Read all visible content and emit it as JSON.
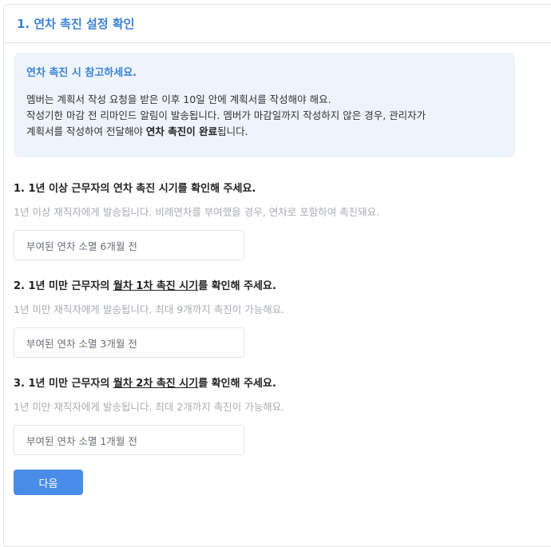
{
  "header": {
    "title": "1. 연차 촉진 설정 확인"
  },
  "notice": {
    "title": "연차 촉진 시 참고하세요.",
    "line1": "멤버는 계획서 작성 요청을 받은 이후 10일 안에 계획서를 작성해야 해요.",
    "line2": "작성기한 마감 전 리마인드 알림이 발송됩니다. 멤버가 마감일까지 작성하지 않은 경우, 관리자가",
    "line3_prefix": "계획서를 작성하여 전달해야 ",
    "line3_bold": "연차 촉진이 완료",
    "line3_suffix": "됩니다."
  },
  "questions": [
    {
      "title_prefix": "1. 1년 이상 근무자의 연차 촉진 시기를 확인해 주세요.",
      "description": "1년 이상 재직자에게 발송됩니다. 비례연차를 부여했을 경우, 연차로 포함하여 촉진돼요.",
      "value": "부여된 연차 소멸 6개월 전"
    },
    {
      "title_prefix": "2. 1년 미만 근무자의 ",
      "title_underline": "월차 1차 촉진 시기",
      "title_suffix": "를 확인해 주세요.",
      "description": "1년 미만 재직자에게 발송됩니다. 최대 9개까지 촉진이 가능해요.",
      "value": "부여된 연차 소멸 3개월 전"
    },
    {
      "title_prefix": "3. 1년 미만 근무자의 ",
      "title_underline": "월차 2차 촉진 시기",
      "title_suffix": "를 확인해 주세요.",
      "description": "1년 미만 재직자에게 발송됩니다. 최대 2개까지 촉진이 가능해요.",
      "value": "부여된 연차 소멸 1개월 전"
    }
  ],
  "actions": {
    "next_label": "다음"
  },
  "colors": {
    "accent": "#3b82d6",
    "button": "#4a8de8",
    "notice_bg": "#eef4fc",
    "muted_text": "#a9adb3"
  }
}
